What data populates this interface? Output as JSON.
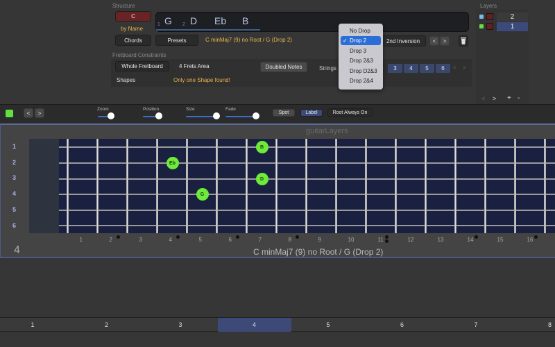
{
  "structure": {
    "section_label": "Structure",
    "root_button": "C",
    "by_name": "by Name",
    "chords_button": "Chords",
    "presets_button": "Presets",
    "chord_name": "C minMaj7 (9) no Root / G (Drop 2)",
    "notes": [
      "G",
      "D",
      "Eb",
      "B"
    ],
    "note_markers": [
      "1",
      "2"
    ],
    "inversion_label": "2nd  Inversion",
    "prev": "<",
    "next": ">"
  },
  "drop_menu": {
    "items": [
      "No Drop",
      "Drop 2",
      "Drop 3",
      "Drop 2&3",
      "Drop D2&3",
      "Drop 2&4"
    ],
    "selected": "Drop 2",
    "check": "✓"
  },
  "constraints": {
    "section_label": "Fretboard Constraints",
    "whole_fretboard": "Whole Fretboard",
    "four_frets": "4 Frets Area",
    "doubled_notes": "Doubled Notes",
    "strings_label": "Strings",
    "strings": [
      "3",
      "4",
      "5",
      "6"
    ],
    "shapes_label": "Shapes",
    "shapes_status": "Only one Shape found!",
    "prev": "<",
    "next": ">"
  },
  "layers": {
    "section_label": "Layers",
    "items": [
      {
        "label": "2",
        "color": "#7ab8f0",
        "selected": false
      },
      {
        "label": "1",
        "color": "#62e040",
        "selected": true
      }
    ],
    "prev": "<",
    "next": ">",
    "add": "+",
    "remove": "-"
  },
  "toolbar": {
    "prev": "<",
    "next": ">",
    "sliders": [
      {
        "label": "Zoom",
        "value": 0.55
      },
      {
        "label": "Position",
        "value": 0.75
      },
      {
        "label": "Size",
        "value": 0.9
      },
      {
        "label": "Fade",
        "value": 0.9
      }
    ],
    "spot": "Spot",
    "label": "Label",
    "root_always_on": "Root Always On"
  },
  "fretboard": {
    "watermark": "guitarLayers",
    "strings": [
      "1",
      "2",
      "3",
      "4",
      "5",
      "6"
    ],
    "fret_numbers": [
      "1",
      "2",
      "3",
      "4",
      "5",
      "6",
      "7",
      "8",
      "9",
      "10",
      "11",
      "12",
      "13",
      "14",
      "15",
      "16"
    ],
    "notes": [
      {
        "name": "B",
        "string": 1,
        "fret": 7
      },
      {
        "name": "Eb",
        "string": 2,
        "fret": 4
      },
      {
        "name": "D",
        "string": 3,
        "fret": 7
      },
      {
        "name": "G",
        "string": 4,
        "fret": 5
      }
    ],
    "position_number": "4",
    "chord_title": "C minMaj7 (9) no Root / G (Drop 2)"
  },
  "pages": {
    "items": [
      "1",
      "2",
      "3",
      "4",
      "5",
      "6",
      "7",
      "8"
    ],
    "selected": "4"
  }
}
